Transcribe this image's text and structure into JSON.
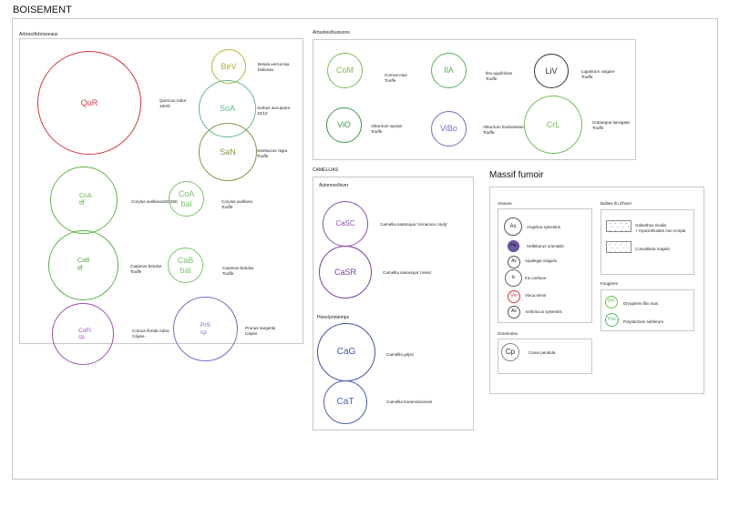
{
  "page": {
    "title": "BOISEMENT",
    "massif_title": "Massif fumoir"
  },
  "arbres": {
    "label": "Arbres/Arbrisseaux",
    "plants": [
      {
        "code": "QuR",
        "name": "Quercus robur\n18/20",
        "color": "#d9363e"
      },
      {
        "code": "BeV",
        "name": "Betula verrucosa\nbaliveau",
        "color": "#b5b23a"
      },
      {
        "code": "SoA",
        "name": "Sorbus aucuparia\n10/12",
        "color": "#5fb88a"
      },
      {
        "code": "SaN",
        "name": "Sambucus nigra\nTouffe",
        "color": "#7f9a4a"
      },
      {
        "code": "CoA\ntff",
        "name": "Corylus avellana200/250",
        "color": "#62b44a"
      },
      {
        "code": "CoA\nbal",
        "name": "Corylus avellana\nTouffe",
        "color": "#7ac46a"
      },
      {
        "code": "CaB\ntff",
        "name": "Carpinus betulus\nTouffe",
        "color": "#55ad45"
      },
      {
        "code": "CaB\nbal",
        "name": "Carpinus betulus\nTouffe",
        "color": "#78c46a"
      },
      {
        "code": "CoFr\ncp",
        "name": "Cornus florida rubra\nCépée",
        "color": "#9a4fb0"
      },
      {
        "code": "PrS\ncp",
        "name": "Prunus sargentii\nCépée",
        "color": "#7d6ac4"
      }
    ]
  },
  "arbustes": {
    "label": "Arbustes/buissons",
    "plants": [
      {
        "code": "CoM",
        "name": "Cornus mas\nTouffe",
        "color": "#7cbf4e"
      },
      {
        "code": "IlA",
        "name": "Ilex aquifolium\nTouffe",
        "color": "#4fb55e"
      },
      {
        "code": "LiV",
        "name": "Ligustrum vulgare\nTouffe",
        "color": "#333333"
      },
      {
        "code": "ViO",
        "name": "Viburnum opulus\nTouffe",
        "color": "#3f9a4a"
      },
      {
        "code": "ViBo",
        "name": "Viburnum bodnantese\nTouffe",
        "color": "#7d6ac4"
      },
      {
        "code": "CrL",
        "name": "Crataegus laevigata\nTouffe",
        "color": "#6fbf52"
      }
    ]
  },
  "camellias": {
    "label": "CAMELLIAS",
    "automne_label": "Automne/hiver",
    "hiver_label": "Hiver/printemps",
    "plants": [
      {
        "code": "CaSC",
        "name": "Camellia sasanqua 'cinnamon cindy'",
        "color": "#8a4fb5"
      },
      {
        "code": "CaSR",
        "name": "Camellia sasanqua 'rosea'",
        "color": "#7a3fa8"
      },
      {
        "code": "CaG",
        "name": "Camellia grijsii",
        "color": "#3f55a8"
      },
      {
        "code": "CaT",
        "name": "Camellia transnokoensis",
        "color": "#4a5fb5"
      }
    ]
  },
  "massif": {
    "vivaces": {
      "label": "Vivaces",
      "plants": [
        {
          "code": "As",
          "name": "Angelica sylvestris",
          "color": "#555555",
          "fill": "none"
        },
        {
          "code": "Ho",
          "name": "Helleborus orientalis",
          "color": "#5b4596",
          "fill": "#6e5aa8"
        },
        {
          "code": "Av",
          "name": "Aquilegia vulgaris",
          "color": "#555555",
          "fill": "none"
        },
        {
          "code": "Ic",
          "name": "Iris confusa",
          "color": "#555555",
          "fill": "none"
        },
        {
          "code": "Vm",
          "name": "Vinca minor",
          "color": "#d9363e",
          "fill": "none"
        },
        {
          "code": "As",
          "name": "Anthriscus sylvestris",
          "color": "#555555",
          "fill": "none"
        }
      ]
    },
    "bulbes": {
      "label": "Bulbes fin d'hiver",
      "items": [
        {
          "name": "Galanthus nivalis\n+ Hyacinthoides non scripta",
          "dot_color": "#5a6fd0"
        },
        {
          "name": "Convallaria majalis",
          "dot_color": "#b07ad0"
        }
      ]
    },
    "fougeres": {
      "label": "Fougères",
      "plants": [
        {
          "code": "DrF",
          "name": "Dryopteris filix mas",
          "color": "#6fbf52"
        },
        {
          "code": "Pos",
          "name": "Polystichum setiferum",
          "color": "#4fb55e"
        }
      ]
    },
    "graminees": {
      "label": "Graminées",
      "plants": [
        {
          "code": "Cp",
          "name": "Carex pendula",
          "color": "#333333"
        }
      ]
    }
  }
}
